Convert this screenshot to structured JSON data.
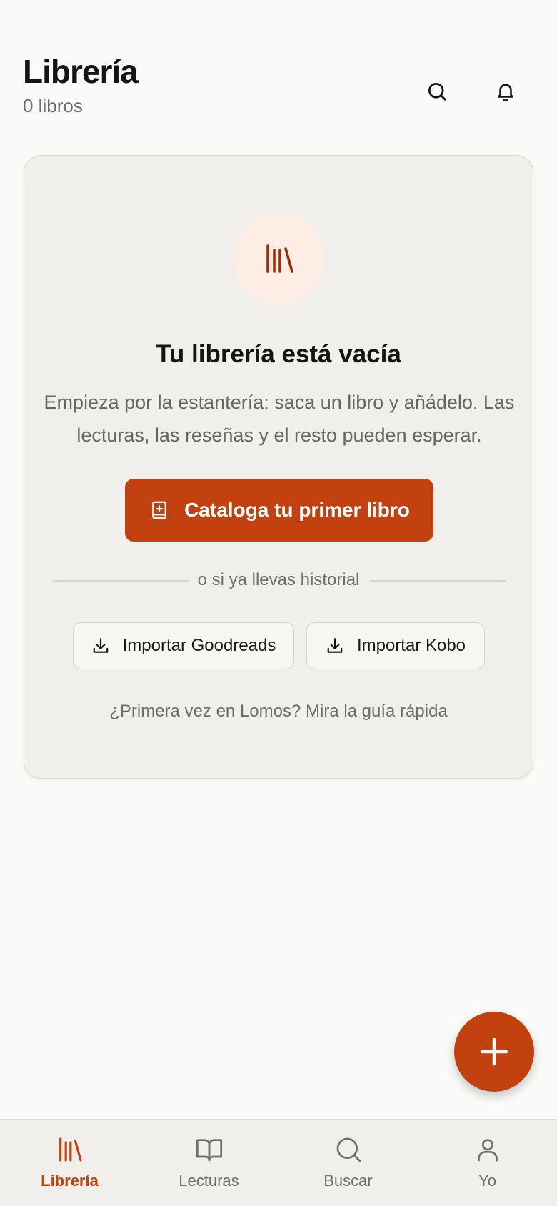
{
  "header": {
    "title": "Librería",
    "book_count": "0 libros"
  },
  "empty_state": {
    "title": "Tu librería está vacía",
    "description": "Empieza por la estantería: saca un libro y añádelo. Las lecturas, las reseñas y el resto pueden esperar.",
    "primary_button": "Cataloga tu primer libro",
    "divider": "o si ya llevas historial",
    "import_goodreads": "Importar Goodreads",
    "import_kobo": "Importar Kobo",
    "guide_link": "¿Primera vez en Lomos? Mira la guía rápida"
  },
  "bottom_nav": {
    "items": [
      {
        "label": "Librería",
        "icon": "library-icon",
        "active": true
      },
      {
        "label": "Lecturas",
        "icon": "open-book-icon",
        "active": false
      },
      {
        "label": "Buscar",
        "icon": "search-icon",
        "active": false
      },
      {
        "label": "Yo",
        "icon": "user-icon",
        "active": false
      }
    ]
  },
  "colors": {
    "accent": "#C2410F",
    "accent_soft": "#FDEDE4",
    "background": "#FAFAF8",
    "card": "#F1EFEB"
  }
}
